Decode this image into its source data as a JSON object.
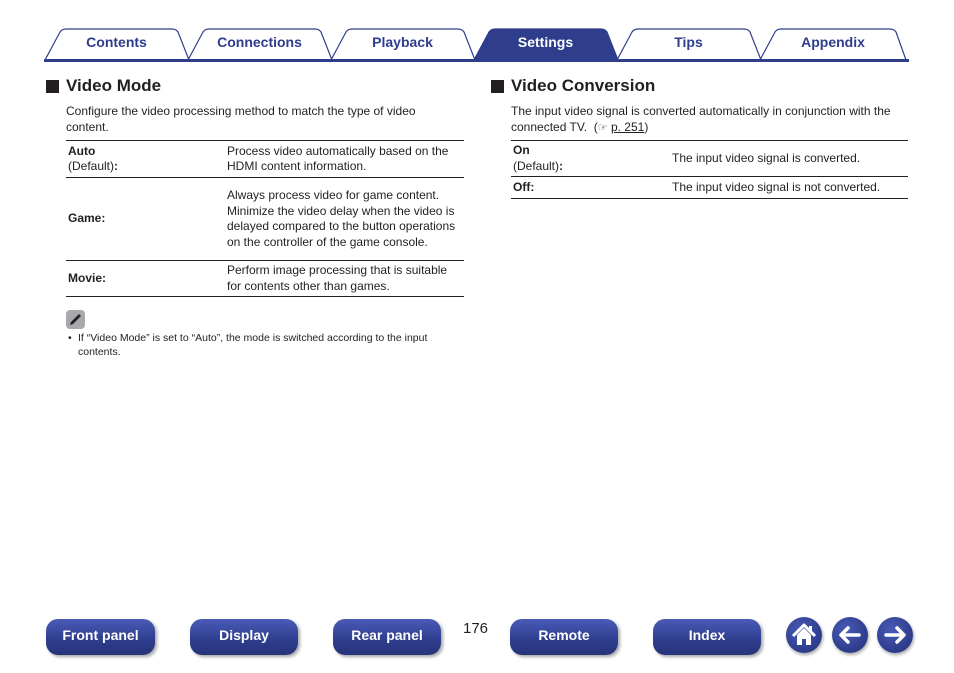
{
  "tabs": [
    {
      "label": "Contents",
      "active": false
    },
    {
      "label": "Connections",
      "active": false
    },
    {
      "label": "Playback",
      "active": false
    },
    {
      "label": "Settings",
      "active": true
    },
    {
      "label": "Tips",
      "active": false
    },
    {
      "label": "Appendix",
      "active": false
    }
  ],
  "colors": {
    "accent": "#2e3d8c",
    "text": "#231f20",
    "note_icon_bg": "#a7a9ac"
  },
  "video_mode": {
    "title": "Video Mode",
    "description": "Configure the video processing method to match the type of video content.",
    "options": [
      {
        "key": "Auto",
        "sub": "(Default)",
        "desc": "Process video automatically based on the HDMI content information."
      },
      {
        "key": "Game",
        "sub": "",
        "desc": "Always process video for game content. Minimize the video delay when the video is delayed compared to the button operations on the controller of the game console."
      },
      {
        "key": "Movie",
        "sub": "",
        "desc": "Perform image processing that is suitable for contents other than games."
      }
    ],
    "note_icon": "pencil-icon",
    "note": "If “Video Mode” is set to “Auto”, the mode is switched according to the input contents."
  },
  "video_conversion": {
    "title": "Video Conversion",
    "description": "The input video signal is converted automatically in conjunction with the connected TV.",
    "ref_icon": "pointing-hand-icon",
    "ref_link": "p. 251",
    "options": [
      {
        "key": "On",
        "sub": "(Default)",
        "desc": "The input video signal is converted."
      },
      {
        "key": "Off",
        "sub": "",
        "desc": "The input video signal is not converted."
      }
    ]
  },
  "footer": {
    "buttons": [
      "Front panel",
      "Display",
      "Rear panel",
      "Remote",
      "Index"
    ],
    "page_number": "176",
    "icons": [
      "home-icon",
      "arrow-left-icon",
      "arrow-right-icon"
    ]
  }
}
